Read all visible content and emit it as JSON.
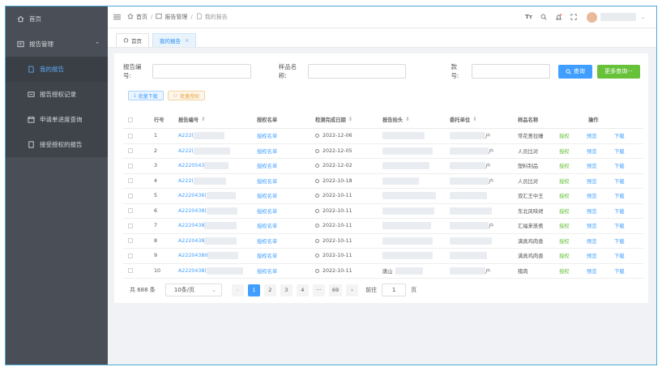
{
  "sidebar": {
    "home": "首页",
    "group": "报告管理",
    "items": [
      "我的报告",
      "报告授权记录",
      "申请单进度查询",
      "接受授权的报告"
    ]
  },
  "header": {
    "breadcrumb": [
      "首页",
      "报告管理",
      "我的报告"
    ]
  },
  "tabs": [
    {
      "label": "首页"
    },
    {
      "label": "我的报告"
    }
  ],
  "form": {
    "report_no_label": "报告编号:",
    "sample_name_label": "样品名称:",
    "model_label": "款号:",
    "search_btn": "查询",
    "more_btn": "更多查询···"
  },
  "tools": {
    "batch_download": "批量下载",
    "batch_auth": "批量授权"
  },
  "table": {
    "headers": [
      "行号",
      "报告编号",
      "授权名单",
      "检测完成日期",
      "报告抬头",
      "委托单位",
      "样品名称",
      "操作"
    ],
    "rows": [
      {
        "idx": "1",
        "no": "A222(",
        "list": "授权名单",
        "date": "2022-12-06",
        "client": "户",
        "name": "常花葱拉睡"
      },
      {
        "idx": "2",
        "no": "A222(",
        "list": "授权名单",
        "date": "2022-12-05",
        "client": "户",
        "name": "人员比对"
      },
      {
        "idx": "3",
        "no": "A2220543",
        "list": "授权名单",
        "date": "2022-12-02",
        "client": "户",
        "name": "塑料制品"
      },
      {
        "idx": "4",
        "no": "A222(",
        "list": "授权名单",
        "date": "2022-10-18",
        "client": "户",
        "name": "人员比对"
      },
      {
        "idx": "5",
        "no": "A2220436(",
        "list": "授权名单",
        "date": "2022-10-11",
        "client": "",
        "name": "双汇王中王"
      },
      {
        "idx": "6",
        "no": "A2220438(",
        "list": "授权名单",
        "date": "2022-10-11",
        "client": "",
        "name": "东北风味烤"
      },
      {
        "idx": "7",
        "no": "A2220438",
        "list": "授权名单",
        "date": "2022-10-11",
        "client": "户",
        "name": "汇福来蒸煮"
      },
      {
        "idx": "8",
        "no": "A2220438",
        "list": "授权名单",
        "date": "2022-10-11",
        "client": "",
        "name": "满真鸡肉香"
      },
      {
        "idx": "9",
        "no": "A22204380",
        "list": "授权名单",
        "date": "2022-10-11",
        "client": "",
        "name": "满真鸡肉香"
      },
      {
        "idx": "10",
        "no": "A2220438(",
        "list": "授权名单",
        "date": "2022-10-11",
        "client": "户",
        "name": "猪肉"
      }
    ],
    "row10_head": "唐山",
    "op_auth": "授权",
    "op_preview": "预览",
    "op_download": "下载"
  },
  "pager": {
    "total": "共 688 条",
    "page_size": "10条/页",
    "pages": [
      "1",
      "2",
      "3",
      "4",
      "···",
      "69"
    ],
    "goto_label": "前往",
    "goto_value": "1",
    "page_suffix": "页"
  },
  "colors": {
    "accent": "#409eff",
    "success": "#67c23a",
    "sidebar": "#4a4f57"
  }
}
